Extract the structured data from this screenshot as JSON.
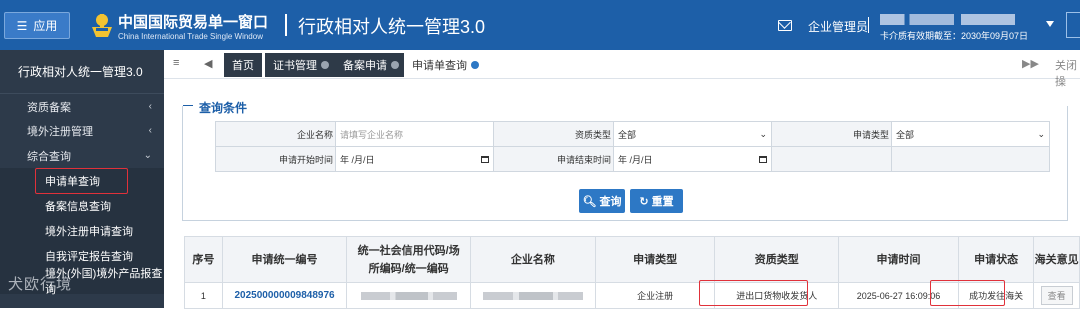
{
  "header": {
    "app_button": "应用",
    "brand_cn": "中国国际贸易单一窗口",
    "brand_en": "China International Trade Single Window",
    "system_title": "行政相对人统一管理3.0",
    "role": "企业管理员",
    "validity": "卡介质有效期截至：2030年09月07日"
  },
  "sidebar": {
    "title": "行政相对人统一管理3.0",
    "items": [
      {
        "label": "资质备案",
        "arrow": "‹"
      },
      {
        "label": "境外注册管理",
        "arrow": "‹"
      },
      {
        "label": "综合查询",
        "arrow": "⌄"
      }
    ],
    "subitems": [
      {
        "label": "申请单查询"
      },
      {
        "label": "备案信息查询"
      },
      {
        "label": "境外注册申请查询"
      },
      {
        "label": "自我评定报告查询"
      },
      {
        "label": "境外(外国)境外产品报查询"
      }
    ],
    "watermark": "犬欧行境"
  },
  "tabs": {
    "items": [
      {
        "label": "首页"
      },
      {
        "label": "证书管理"
      },
      {
        "label": "备案申请"
      },
      {
        "label": "申请单查询"
      }
    ],
    "close_all": "关闭操"
  },
  "query": {
    "legend": "查询条件",
    "company_label": "企业名称",
    "company_placeholder": "请填写企业名称",
    "qual_label": "资质类型",
    "qual_value": "全部",
    "apptype_label": "申请类型",
    "apptype_value": "全部",
    "start_label": "申请开始时间",
    "start_value": "年 /月/日",
    "end_label": "申请结束时间",
    "end_value": "年 /月/日",
    "search_button": "查询",
    "reset_button": "重置"
  },
  "results": {
    "headers": [
      "序号",
      "申请统一编号",
      "统一社会信用代码/场所编码/统一编码",
      "企业名称",
      "申请类型",
      "资质类型",
      "申请时间",
      "申请状态",
      "海关意见"
    ],
    "rows": [
      {
        "index": "1",
        "code": "202500000009848976",
        "apptype": "企业注册",
        "qual": "进出口货物收发货人",
        "time": "2025-06-27 16:09:06",
        "status": "成功发往海关",
        "opinion": "查看"
      }
    ]
  }
}
